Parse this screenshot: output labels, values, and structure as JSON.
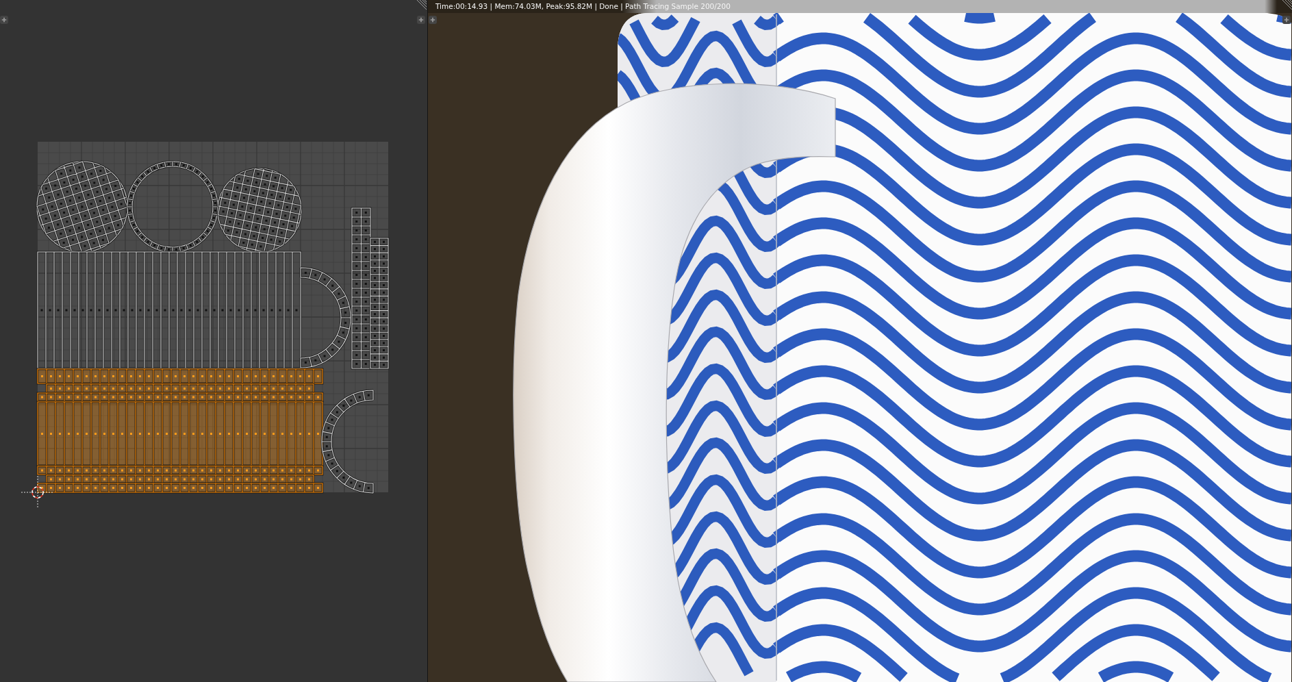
{
  "uv_editor": {
    "islands": [
      {
        "kind": "sphere",
        "selected": false
      },
      {
        "kind": "ring",
        "selected": false
      },
      {
        "kind": "sphere",
        "selected": false
      },
      {
        "kind": "column",
        "selected": false
      },
      {
        "kind": "column",
        "selected": false
      },
      {
        "kind": "strip",
        "selected": false
      },
      {
        "kind": "arc",
        "selected": false
      },
      {
        "kind": "panel",
        "selected": true
      },
      {
        "kind": "arc",
        "selected": false
      }
    ]
  },
  "render_view": {
    "status": "Time:00:14.93 | Mem:74.03M, Peak:95.82M | Done | Path Tracing Sample 200/200"
  }
}
